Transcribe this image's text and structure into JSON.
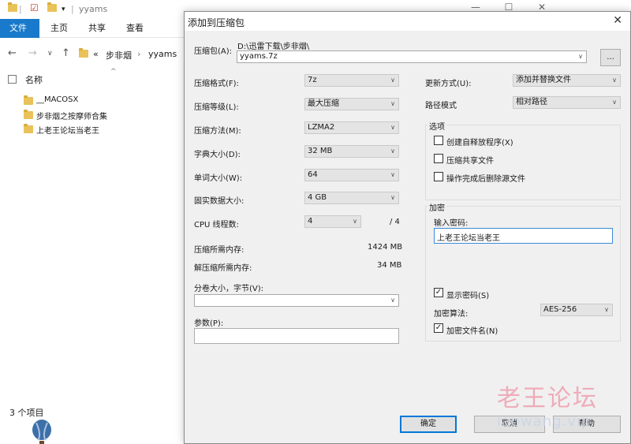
{
  "explorer": {
    "title": "yyams",
    "ribbon_tabs": [
      "文件",
      "主页",
      "共享",
      "查看"
    ],
    "breadcrumb": {
      "prefix": "«",
      "items": [
        "步非烟",
        "yyams"
      ]
    },
    "column_name": "名称",
    "files": [
      "__MACOSX",
      "步非烟之按摩师合集",
      "上老王论坛当老王"
    ],
    "status": "3 个项目"
  },
  "dialog": {
    "title": "添加到压缩包",
    "archive_label": "压缩包(A):",
    "archive_path": "D:\\迅雷下载\\步非烟\\",
    "archive_name": "yyams.7z",
    "browse_label": "...",
    "left_fields": [
      {
        "label": "压缩格式(F):",
        "value": "7z"
      },
      {
        "label": "压缩等级(L):",
        "value": "最大压缩"
      },
      {
        "label": "压缩方法(M):",
        "value": "LZMA2"
      },
      {
        "label": "字典大小(D):",
        "value": "32 MB"
      },
      {
        "label": "单词大小(W):",
        "value": "64"
      },
      {
        "label": "固实数据大小:",
        "value": "4 GB"
      }
    ],
    "cpu_label": "CPU 线程数:",
    "cpu_value": "4",
    "cpu_total": "/ 4",
    "mem_compress_label": "压缩所需内存:",
    "mem_compress_value": "1424 MB",
    "mem_decompress_label": "解压缩所需内存:",
    "mem_decompress_value": "34 MB",
    "split_label": "分卷大小，字节(V):",
    "split_value": "",
    "params_label": "参数(P):",
    "params_value": "",
    "update_label": "更新方式(U):",
    "update_value": "添加并替换文件",
    "path_label": "路径模式",
    "path_value": "相对路径",
    "options_title": "选项",
    "options": [
      {
        "label": "创建自释放程序(X)",
        "checked": false
      },
      {
        "label": "压缩共享文件",
        "checked": false
      },
      {
        "label": "操作完成后删除源文件",
        "checked": false
      }
    ],
    "encrypt_title": "加密",
    "password_label": "输入密码:",
    "password_value": "上老王论坛当老王",
    "show_password_label": "显示密码(S)",
    "show_password_checked": true,
    "encrypt_method_label": "加密算法:",
    "encrypt_method_value": "AES-256",
    "encrypt_names_label": "加密文件名(N)",
    "encrypt_names_checked": true,
    "buttons": {
      "ok": "确定",
      "cancel": "取消",
      "help": "帮助"
    }
  },
  "watermark": {
    "cn": "老王论坛",
    "en": "laowang.vip"
  },
  "colors": {
    "accent": "#1979ca",
    "dialog_bg": "#f0f0f0",
    "watermark": "#ef9fb0"
  }
}
